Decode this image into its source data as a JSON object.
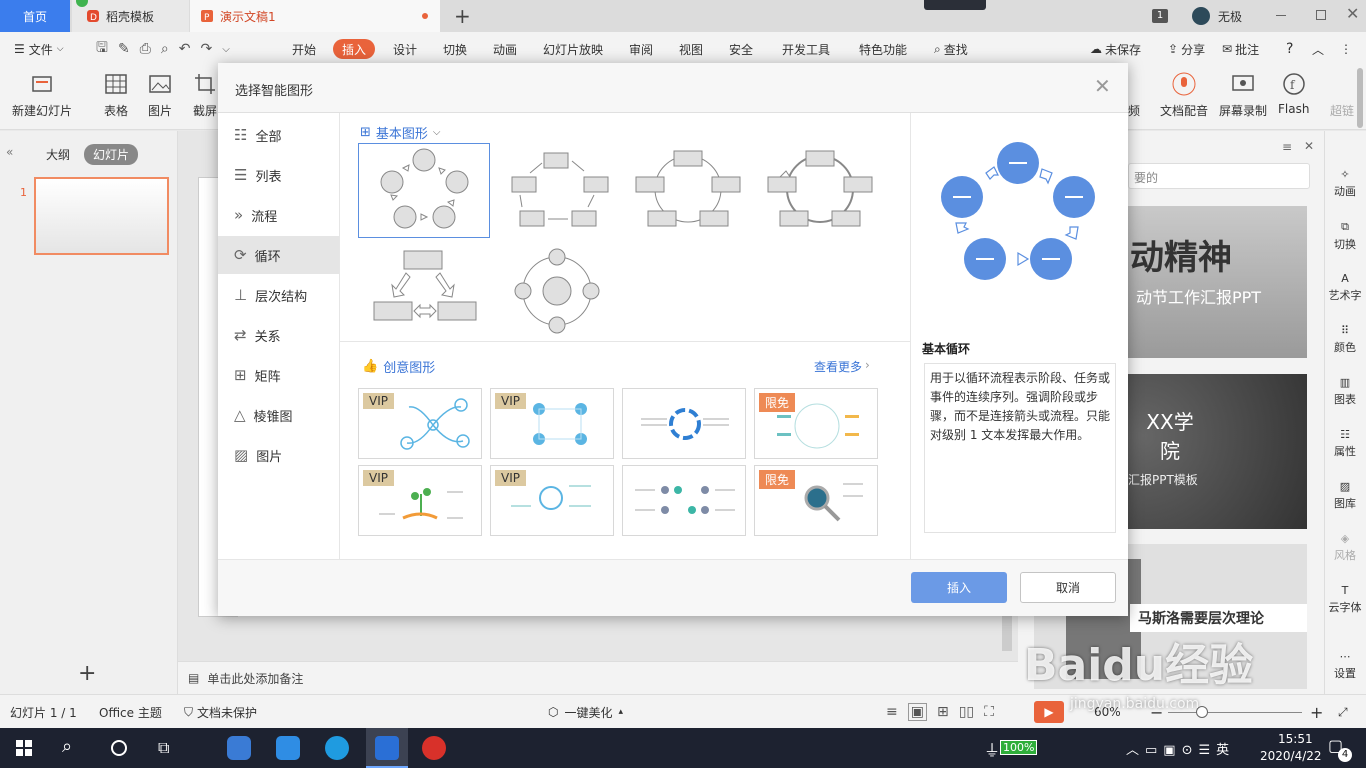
{
  "tabs": {
    "home": "首页",
    "docer": "稻壳模板",
    "doc": "演示文稿1",
    "new_tab": "+",
    "badge_count": "1",
    "user": "无极"
  },
  "menu": {
    "file": "文件",
    "items": [
      "开始",
      "插入",
      "设计",
      "切换",
      "动画",
      "幻灯片放映",
      "审阅",
      "视图",
      "安全",
      "开发工具",
      "特色功能"
    ],
    "search": "查找",
    "unsaved": "未保存",
    "share": "分享",
    "comment": "批注",
    "help": "?"
  },
  "ribbon": {
    "new_slide": "新建幻灯片",
    "table": "表格",
    "picture": "图片",
    "screenshot": "截屏",
    "audio_partial": "频",
    "text_voice": "文档配音",
    "screen_record": "屏幕录制",
    "flash": "Flash",
    "superlink": "超链"
  },
  "left_pane": {
    "outline": "大纲",
    "slides": "幻灯片",
    "slide_num": "1",
    "add": "+"
  },
  "notes": "单击此处添加备注",
  "status": {
    "slide_info": "幻灯片 1 / 1",
    "theme": "Office 主题",
    "protect": "文档未保护",
    "beautify": "一键美化",
    "zoom": "60%"
  },
  "task_pane": {
    "search_placeholder": "要的",
    "cards": [
      {
        "title": "动精神",
        "subtitle": "动节工作汇报PPT"
      },
      {
        "title": "XX学院",
        "subtitle": "毕业汇报PPT模板"
      },
      {
        "title": "马斯洛需要层次理论",
        "subtitle": ""
      }
    ]
  },
  "right_bar": [
    "动画",
    "切换",
    "艺术字",
    "颜色",
    "图表",
    "属性",
    "图库",
    "风格",
    "云字体",
    "设置"
  ],
  "taskbar": {
    "battery": "100%",
    "time": "15:51",
    "date": "2020/4/22",
    "notif": "4"
  },
  "watermark": {
    "brand": "Baidu经验",
    "url": "jingyan.baidu.com"
  },
  "dialog": {
    "title": "选择智能图形",
    "categories": [
      "全部",
      "列表",
      "流程",
      "循环",
      "层次结构",
      "关系",
      "矩阵",
      "棱锥图",
      "图片"
    ],
    "selected_category": "循环",
    "basic_section": "基本图形",
    "creative_section": "创意图形",
    "see_more": "查看更多",
    "creative_badges": [
      "VIP",
      "VIP",
      "",
      "限免",
      "VIP",
      "VIP",
      "",
      "限免"
    ],
    "preview_title": "基本循环",
    "preview_desc": "用于以循环流程表示阶段、任务或事件的连续序列。强调阶段或步骤，而不是连接箭头或流程。只能对级别 1 文本发挥最大作用。",
    "insert_label": "插入",
    "cancel_label": "取消",
    "colors": {
      "accent": "#5b8fe0",
      "insert_btn": "#6b9ae6",
      "badge_vip": "#dcc9a0",
      "badge_free": "#ee8a55"
    }
  }
}
